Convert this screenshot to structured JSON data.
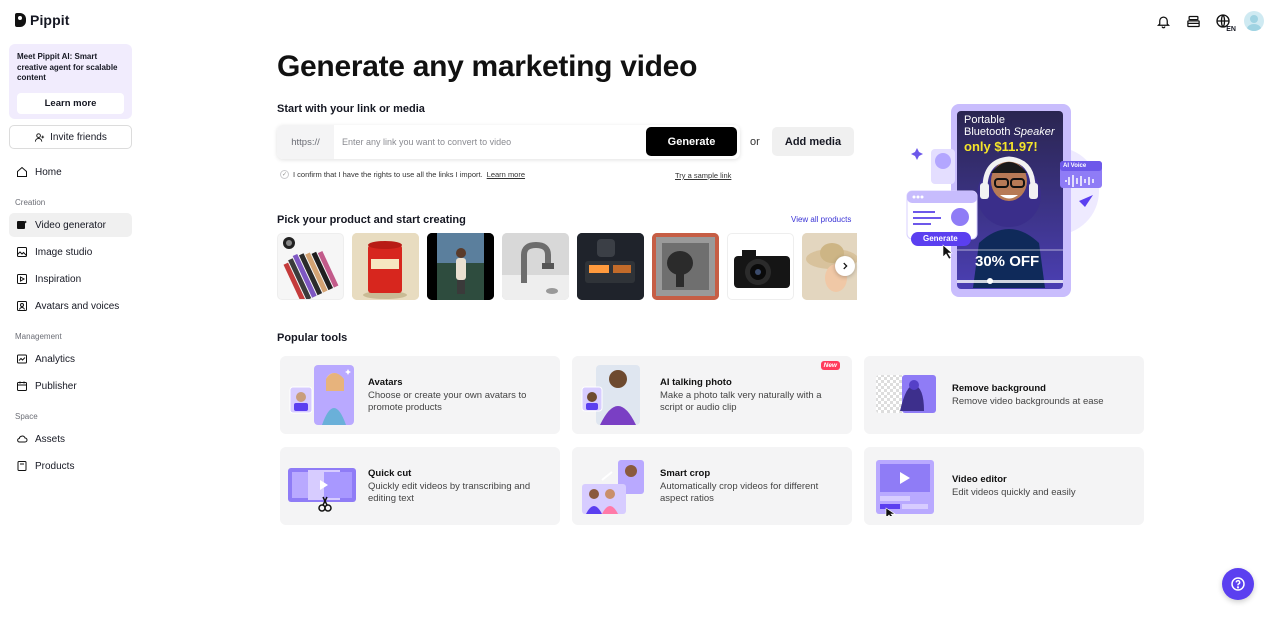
{
  "app": {
    "name": "Pippit"
  },
  "topbar": {
    "icons": [
      "bell-icon",
      "layers-icon",
      "globe-icon",
      "avatar"
    ],
    "language": "EN"
  },
  "sidebar": {
    "promo": {
      "text": "Meet Pippit AI: Smart creative agent for scalable content",
      "button": "Learn more"
    },
    "invite": "Invite friends",
    "home": "Home",
    "sections": {
      "creation": "Creation",
      "management": "Management",
      "space": "Space"
    },
    "items": {
      "video_generator": "Video generator",
      "image_studio": "Image studio",
      "inspiration": "Inspiration",
      "avatars_voices": "Avatars and voices",
      "analytics": "Analytics",
      "publisher": "Publisher",
      "assets": "Assets",
      "products": "Products"
    }
  },
  "main": {
    "title": "Generate any marketing video",
    "link_section_title": "Start with your link or media",
    "link_prefix": "https://",
    "link_placeholder": "Enter any link you want to convert to video",
    "generate": "Generate",
    "or": "or",
    "add_media": "Add media",
    "confirm_text": "I confirm that I have the rights to use all the links I import.",
    "confirm_learn_more": "Learn more",
    "try_sample": "Try a sample link",
    "products_title": "Pick your product and start creating",
    "view_all": "View all products",
    "popular_title": "Popular tools",
    "tools": [
      {
        "title": "Avatars",
        "desc": "Choose or create your own avatars to promote products"
      },
      {
        "title": "AI talking photo",
        "desc": "Make a photo talk very naturally with a script or audio clip",
        "badge": "New"
      },
      {
        "title": "Remove background",
        "desc": "Remove video backgrounds at ease"
      },
      {
        "title": "Quick cut",
        "desc": "Quickly edit videos by transcribing and editing text"
      },
      {
        "title": "Smart crop",
        "desc": "Automatically crop videos for different aspect ratios"
      },
      {
        "title": "Video editor",
        "desc": "Edit videos quickly and easily"
      }
    ]
  },
  "hero": {
    "line1": "Portable",
    "line2": "Bluetooth",
    "line2b": "Speaker",
    "price": "only $11.97!",
    "discount": "30% OFF",
    "ai_voice": "AI Voice",
    "generate": "Generate"
  },
  "colors": {
    "accent": "#5b3ff0",
    "link": "#3a33d6",
    "card_bg": "#f4f4f5",
    "new_badge": "#ff3b5c"
  }
}
